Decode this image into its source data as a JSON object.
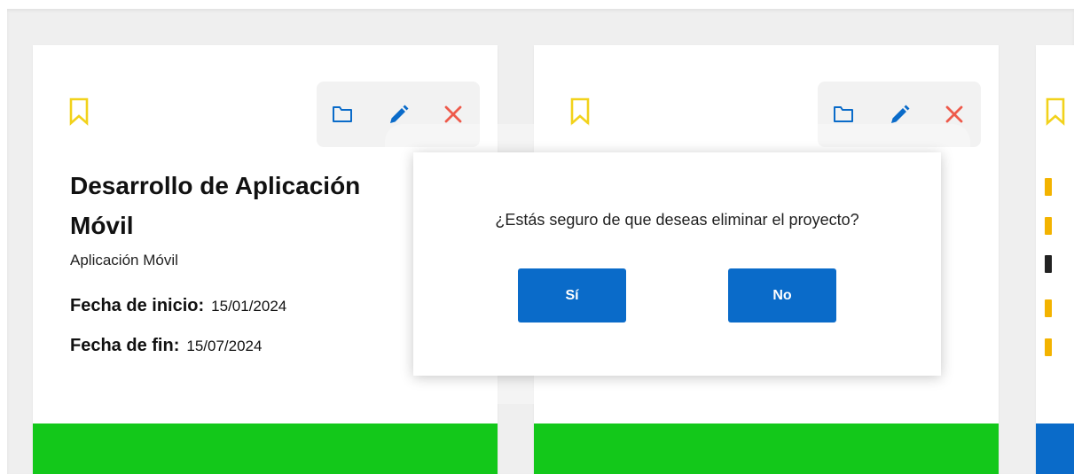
{
  "colors": {
    "accent_blue": "#0a6bc9",
    "success_green": "#13c81a",
    "bookmark_yellow": "#f2d21b",
    "delete_red": "#ee5a4b"
  },
  "icons": {
    "bookmark": "bookmark-icon",
    "folder": "folder-icon",
    "edit": "pencil-icon",
    "delete": "close-icon"
  },
  "cards": [
    {
      "title": "Desarrollo de Aplicación Móvil",
      "category": "Aplicación Móvil",
      "start_label": "Fecha de inicio:",
      "start_date": "15/01/2024",
      "end_label": "Fecha de fin:",
      "end_date": "15/07/2024"
    }
  ],
  "modal": {
    "message": "¿Estás seguro de que deseas eliminar el proyecto?",
    "yes_label": "Sí",
    "no_label": "No"
  }
}
